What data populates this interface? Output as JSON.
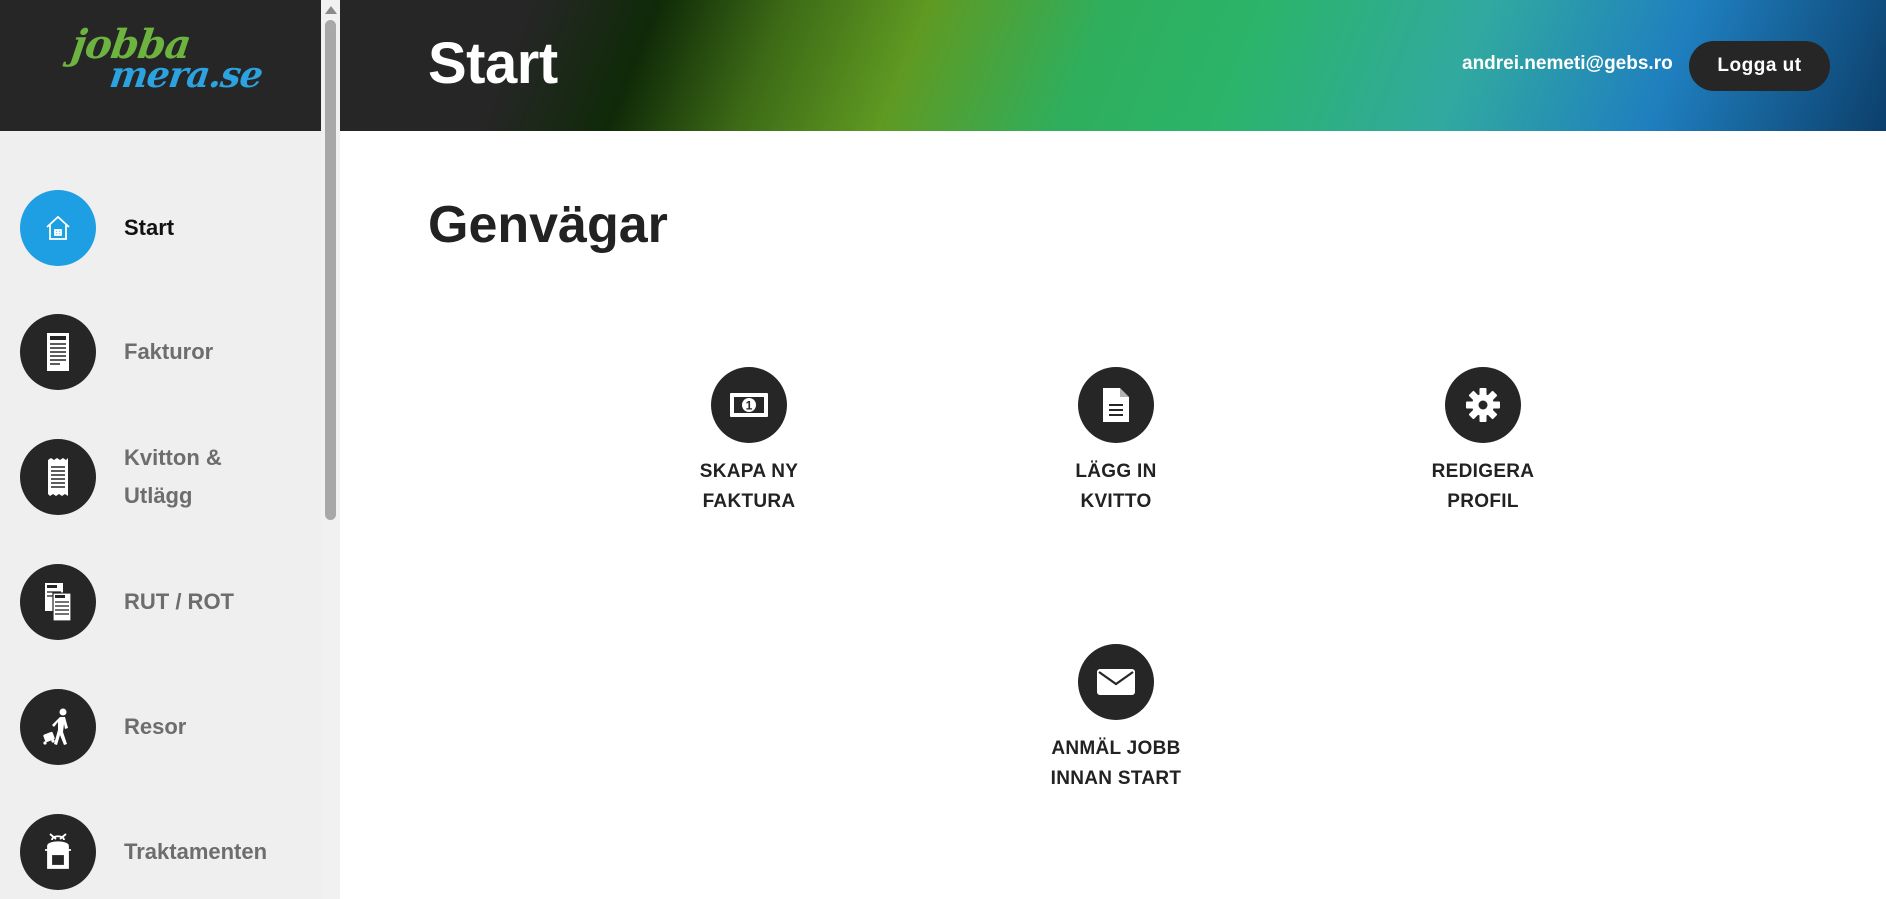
{
  "logo": {
    "line1": "jobba",
    "line2": "mera.se"
  },
  "header": {
    "title": "Start",
    "user_email": "andrei.nemeti@gebs.ro",
    "logout_label": "Logga ut"
  },
  "sidebar": {
    "items": [
      {
        "label": "Start",
        "icon": "home-icon",
        "active": true
      },
      {
        "label": "Fakturor",
        "icon": "invoice-icon"
      },
      {
        "label": "Kvitton &",
        "label2": "Utlägg",
        "icon": "receipt-icon"
      },
      {
        "label": "RUT / ROT",
        "icon": "rut-rot-icon"
      },
      {
        "label": "Resor",
        "icon": "traveler-icon"
      },
      {
        "label": "Traktamenten",
        "icon": "backpack-icon"
      }
    ]
  },
  "main": {
    "section_title": "Genvägar",
    "shortcuts": [
      {
        "line1": "SKAPA NY",
        "line2": "FAKTURA",
        "icon": "banknote-icon"
      },
      {
        "line1": "LÄGG IN",
        "line2": "KVITTO",
        "icon": "document-icon"
      },
      {
        "line1": "REDIGERA",
        "line2": "PROFIL",
        "icon": "gear-icon"
      },
      {
        "line1": "ANMÄL JOBB",
        "line2": "INNAN START",
        "icon": "envelope-icon"
      }
    ]
  },
  "colors": {
    "accent": "#1e9fe3",
    "dark": "#262626",
    "sidebar_bg": "#efefef",
    "logo_green": "#6db33f",
    "logo_blue": "#2ca3e0"
  }
}
